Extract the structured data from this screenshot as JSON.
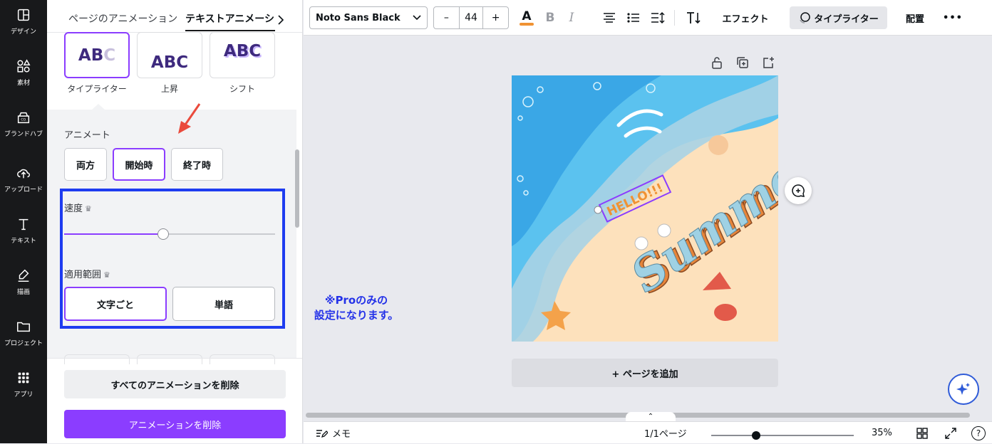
{
  "rail": {
    "items": [
      {
        "label": "デザイン",
        "icon": "layout-icon"
      },
      {
        "label": "素材",
        "icon": "shapes-icon"
      },
      {
        "label": "ブランドハブ",
        "icon": "brand-hub-icon"
      },
      {
        "label": "アップロード",
        "icon": "upload-cloud-icon"
      },
      {
        "label": "テキスト",
        "icon": "text-icon"
      },
      {
        "label": "描画",
        "icon": "draw-icon"
      },
      {
        "label": "プロジェクト",
        "icon": "folder-icon"
      },
      {
        "label": "アプリ",
        "icon": "apps-grid-icon"
      }
    ]
  },
  "panel": {
    "tabs": {
      "page": "ページのアニメーション",
      "text": "テキストアニメーション"
    },
    "tiles": [
      {
        "preview": "ABC",
        "label": "タイプライター",
        "selected": true
      },
      {
        "preview": "ABC",
        "label": "上昇",
        "selected": false
      },
      {
        "preview": "ABC",
        "label": "シフト",
        "selected": false
      }
    ],
    "animate_label": "アニメート",
    "animate_buttons": [
      {
        "label": "両方",
        "selected": false
      },
      {
        "label": "開始時",
        "selected": true
      },
      {
        "label": "終了時",
        "selected": false
      }
    ],
    "speed_label": "速度",
    "speed_value": 0.47,
    "scope_label": "適用範囲",
    "scope_buttons": [
      {
        "label": "文字ごと",
        "selected": true
      },
      {
        "label": "単語",
        "selected": false
      }
    ],
    "delete_all": "すべてのアニメーションを削除",
    "delete": "アニメーションを削除",
    "crown_glyph": "♛"
  },
  "toolbar": {
    "font": "Noto Sans Black",
    "font_size": "44",
    "minus": "–",
    "plus": "+",
    "text_color_letter": "A",
    "bold_letter": "B",
    "italic_letter": "I",
    "effects": "エフェクト",
    "typewriter": "タイプライター",
    "position": "配置",
    "more": "•••",
    "text_color_accent": "#f09233"
  },
  "canvas": {
    "add_page": "+ ページを追加",
    "design_texts": {
      "hello": "HELLO!!!",
      "summer": "Summer"
    },
    "note_line1": "※Proのみの",
    "note_line2": "設定になります。",
    "note_color": "#2432e8"
  },
  "status": {
    "notes": "メモ",
    "page_count": "1/1ページ",
    "zoom": "35%",
    "zoom_level": 0.3,
    "help": "?"
  },
  "colors": {
    "accent": "#8b3dff",
    "highlight_box": "#1e3cf0",
    "arrow": "#ea4a3c"
  }
}
